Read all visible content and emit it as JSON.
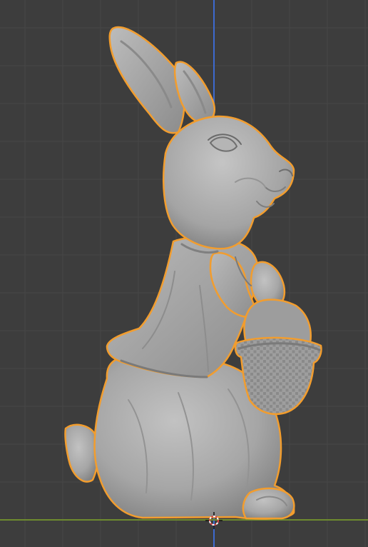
{
  "viewport": {
    "background_color": "#3d3d3d",
    "grid_color": "#474747",
    "grid_major_color": "#4f4f4f",
    "axis_y_color": "#3d6ad0",
    "axis_x_color": "#6e8b2e",
    "selection_outline_color": "#f29d2e",
    "model_color": "#a9a9a9",
    "model_shadow_color": "#7a7a7a",
    "model_highlight_color": "#c7c7c7"
  },
  "scene": {
    "selected_object": "easter-bunny-sculpture",
    "cursor_icon": "3d-cursor-icon"
  }
}
